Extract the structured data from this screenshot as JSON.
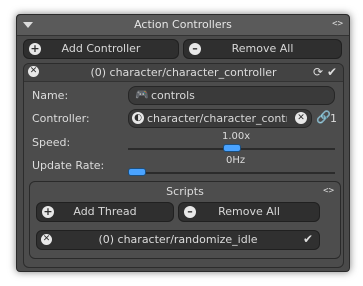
{
  "panel": {
    "title": "Action Controllers",
    "code_icon": "<>",
    "add_controller": "Add Controller",
    "remove_all": "Remove All"
  },
  "controller": {
    "title": "(0) character/character_controller",
    "name_label": "Name:",
    "name_value": "controls",
    "controller_label": "Controller:",
    "controller_value": "character/character_contr",
    "link_count": "1",
    "speed_label": "Speed:",
    "speed_value": "1.00x",
    "speed_fraction": 0.5,
    "update_label": "Update Rate:",
    "update_value": "0Hz",
    "update_fraction": 0.0
  },
  "scripts": {
    "title": "Scripts",
    "code_icon": "<>",
    "add_thread": "Add Thread",
    "remove_all": "Remove All",
    "items": [
      {
        "label": "(0) character/randomize_idle",
        "enabled": true
      }
    ]
  },
  "colors": {
    "accent": "#4aa3ff",
    "panel_bg": "#4a4a4a",
    "button_bg": "#2f2f2f"
  }
}
